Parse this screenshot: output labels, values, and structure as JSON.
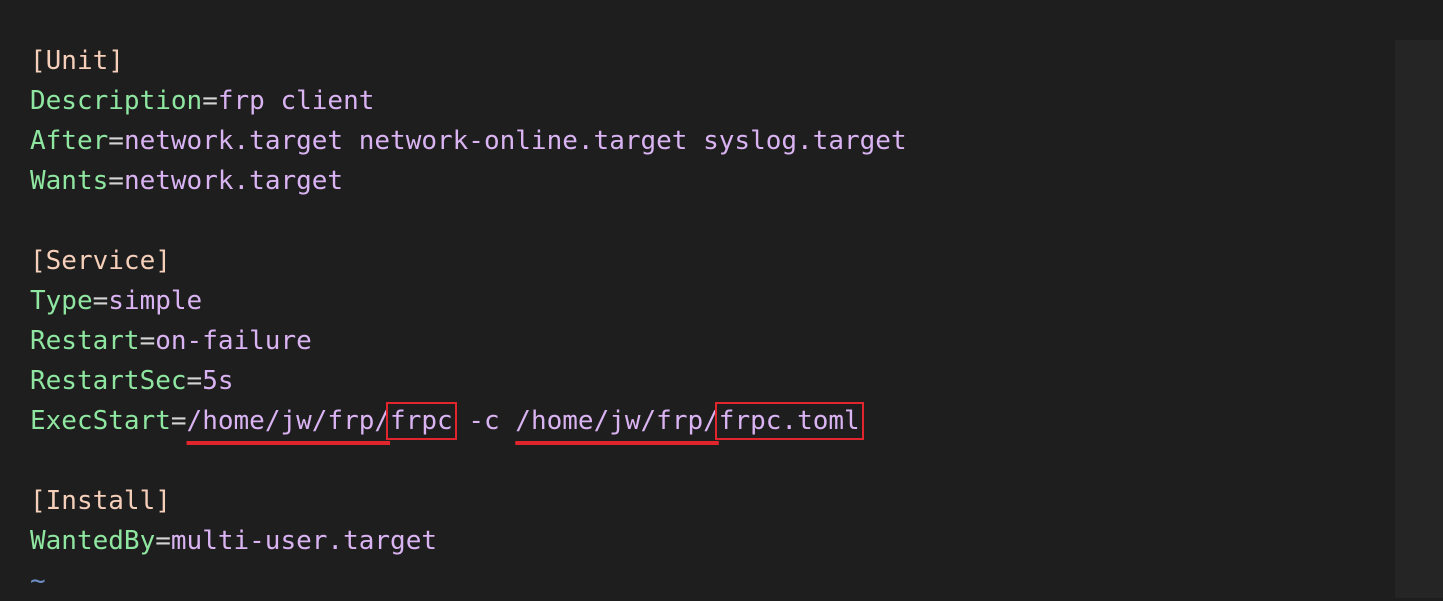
{
  "file": {
    "unit_section": "[Unit]",
    "description_key": "Description",
    "description_value": "frp client",
    "after_key": "After",
    "after_value": "network.target network-online.target syslog.target",
    "wants_key": "Wants",
    "wants_value": "network.target",
    "service_section": "[Service]",
    "type_key": "Type",
    "type_value": "simple",
    "restart_key": "Restart",
    "restart_value": "on-failure",
    "restartsec_key": "RestartSec",
    "restartsec_value": "5s",
    "execstart_key": "ExecStart",
    "exec_path_1": "/home/jw/frp/",
    "exec_binary": "frpc",
    "exec_flag": " -c ",
    "exec_path_2": "/home/jw/frp/",
    "exec_config": "frpc.toml",
    "install_section": "[Install]",
    "wantedby_key": "WantedBy",
    "wantedby_value": "multi-user.target",
    "eof_marker": "~"
  },
  "colors": {
    "background": "#1e1e1e",
    "section": "#f5cfb9",
    "key": "#8ee6a0",
    "value": "#d9b3f2",
    "annotation_red": "#e0262c"
  }
}
